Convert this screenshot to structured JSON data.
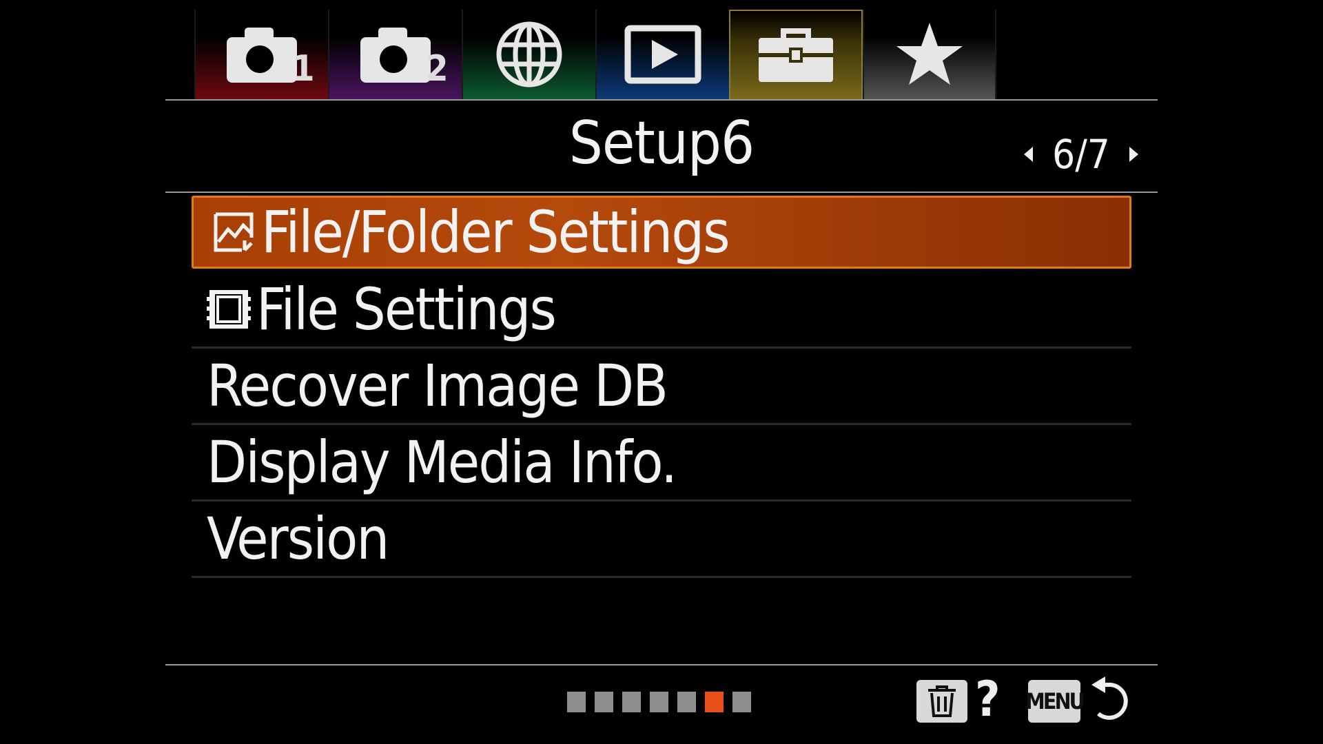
{
  "tabs": [
    {
      "icon": "camera-icon",
      "number": "1",
      "color": "#6e0a10",
      "active": false
    },
    {
      "icon": "camera-icon",
      "number": "2",
      "color": "#4a1460",
      "active": false
    },
    {
      "icon": "globe-icon",
      "number": "",
      "color": "#0c5a2e",
      "active": false
    },
    {
      "icon": "play-icon",
      "number": "",
      "color": "#0c3a7a",
      "active": false
    },
    {
      "icon": "toolbox-icon",
      "number": "",
      "color": "#7a6a1a",
      "active": true
    },
    {
      "icon": "star-icon",
      "number": "",
      "color": "#555555",
      "active": false
    }
  ],
  "header": {
    "title": "Setup6",
    "page": "6/7"
  },
  "menu": {
    "items": [
      {
        "label": "File/Folder Settings",
        "icon": "photo-icon",
        "selected": true
      },
      {
        "label": "File Settings",
        "icon": "film-icon",
        "selected": false
      },
      {
        "label": "Recover Image DB",
        "icon": "",
        "selected": false
      },
      {
        "label": "Display Media Info.",
        "icon": "",
        "selected": false
      },
      {
        "label": "Version",
        "icon": "",
        "selected": false
      }
    ]
  },
  "footer": {
    "page_count": 7,
    "active_page": 6,
    "help": "?",
    "menu_label": "MENU"
  },
  "colors": {
    "selection": "#b44a0c",
    "active_dot": "#e8501a"
  }
}
